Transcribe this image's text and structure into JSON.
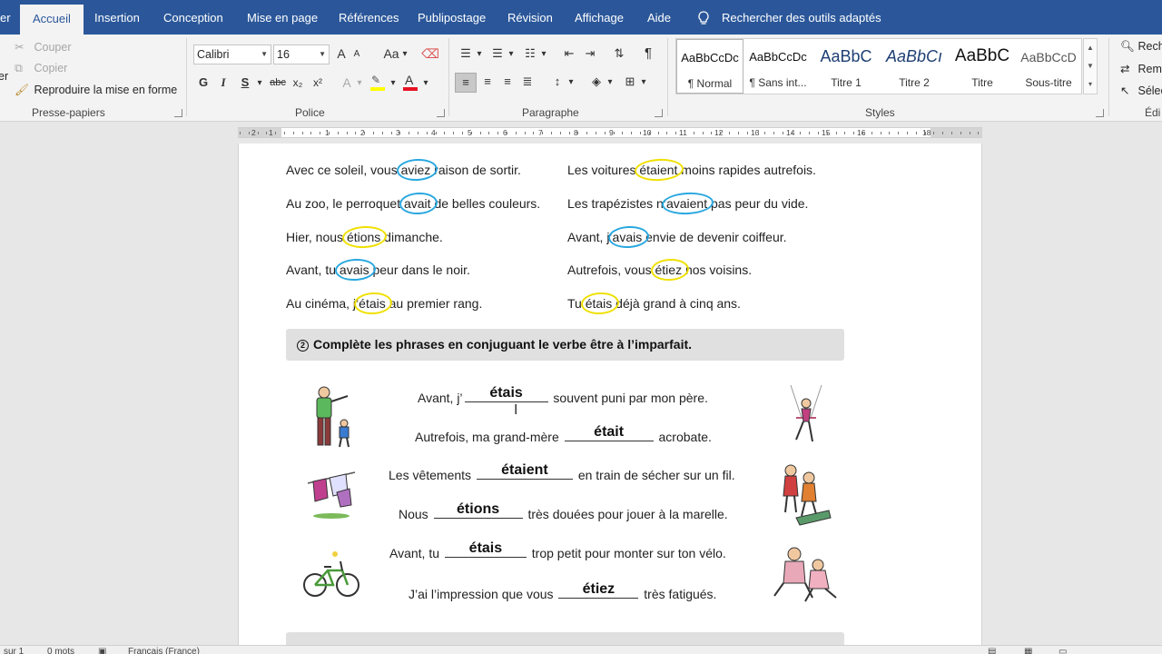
{
  "ribbon_tabs": {
    "file_partial": "er",
    "home": "Accueil",
    "insert": "Insertion",
    "design": "Conception",
    "layout": "Mise en page",
    "references": "Références",
    "mailings": "Publipostage",
    "review": "Révision",
    "view": "Affichage",
    "help": "Aide",
    "tell_me": "Rechercher des outils adaptés"
  },
  "clipboard": {
    "paste_partial": "er",
    "cut": "Couper",
    "copy": "Copier",
    "format_painter": "Reproduire la mise en forme",
    "label": "Presse-papiers"
  },
  "font": {
    "name": "Calibri",
    "size": "16",
    "label": "Police",
    "bold": "G",
    "italic": "I",
    "underline": "S",
    "strike": "abc",
    "subscript": "x₂",
    "superscript": "x²",
    "grow": "A",
    "shrink": "A",
    "case": "Aa",
    "color_letter": "A",
    "effects_letter": "A",
    "font_color": "#e81123",
    "highlight_color": "#ffff00"
  },
  "paragraph": {
    "label": "Paragraphe",
    "pilcrow": "¶"
  },
  "styles": {
    "label": "Styles",
    "items": [
      {
        "preview": "AaBbCcDc",
        "name": "¶ Normal"
      },
      {
        "preview": "AaBbCcDc",
        "name": "¶ Sans int..."
      },
      {
        "preview": "AaBbC",
        "name": "Titre 1"
      },
      {
        "preview": "AaBbCı",
        "name": "Titre 2"
      },
      {
        "preview": "AaBbC",
        "name": "Titre"
      },
      {
        "preview": "AaBbCcD",
        "name": "Sous-titre"
      }
    ]
  },
  "editing": {
    "find": "Rech",
    "replace": "Remp",
    "select": "Sélec",
    "label": "Édi"
  },
  "ruler": {
    "numbers": [
      "2",
      "1",
      "1",
      "2",
      "3",
      "4",
      "5",
      "6",
      "7",
      "8",
      "9",
      "10",
      "11",
      "12",
      "13",
      "14",
      "15",
      "16",
      "18"
    ]
  },
  "document": {
    "sentences_left": [
      {
        "before": "Avec ce soleil, vous ",
        "word": "aviez",
        "after": " raison de sortir.",
        "mark": "blue"
      },
      {
        "before": "Au zoo, le perroquet ",
        "word": "avait",
        "after": " de belles couleurs.",
        "mark": "blue"
      },
      {
        "before": "Hier, nous ",
        "word": "étions",
        "after": " dimanche.",
        "mark": "yellow"
      },
      {
        "before": "Avant, tu ",
        "word": "avais",
        "after": " peur dans le noir.",
        "mark": "blue"
      },
      {
        "before": "Au cinéma, j’",
        "word": "étais",
        "after": " au premier rang.",
        "mark": "yellow"
      }
    ],
    "sentences_right": [
      {
        "before": "Les voitures ",
        "word": "étaient",
        "after": " moins rapides autrefois.",
        "mark": "yellow"
      },
      {
        "before": "Les trapézistes n’",
        "word": "avaient",
        "after": " pas peur du vide.",
        "mark": "blue"
      },
      {
        "before": "Avant, j’",
        "word": "avais",
        "after": " envie de devenir coiffeur.",
        "mark": "blue"
      },
      {
        "before": "Autrefois, vous ",
        "word": "étiez",
        "after": " nos voisins.",
        "mark": "yellow"
      },
      {
        "before": "Tu ",
        "word": "étais",
        "after": " déjà grand à cinq ans.",
        "mark": "yellow"
      }
    ],
    "section_number": "2",
    "section_title": "Complète les phrases en conjuguant le verbe être à l’imparfait.",
    "exercises": [
      {
        "before": "Avant, j’",
        "answer": "étais",
        "after": " souvent puni par mon père."
      },
      {
        "before": "Autrefois, ma grand-mère ",
        "answer": "était",
        "after": " acrobate."
      },
      {
        "before": "Les vêtements ",
        "answer": "étaient",
        "after": " en train de sécher sur un fil."
      },
      {
        "before": "Nous ",
        "answer": "étions",
        "after": " très douées pour jouer à la marelle."
      },
      {
        "before": "Avant, tu ",
        "answer": "étais",
        "after": " trop petit pour monter sur ton vélo."
      },
      {
        "before": "J’ai l’impression que vous ",
        "answer": "étiez",
        "after": " très fatigués."
      }
    ],
    "mark_colors": {
      "blue": "#29a8e0",
      "yellow": "#f0e000"
    }
  },
  "statusbar": {
    "page": "sur 1",
    "words": "0 mots",
    "language": "Français (France)"
  }
}
